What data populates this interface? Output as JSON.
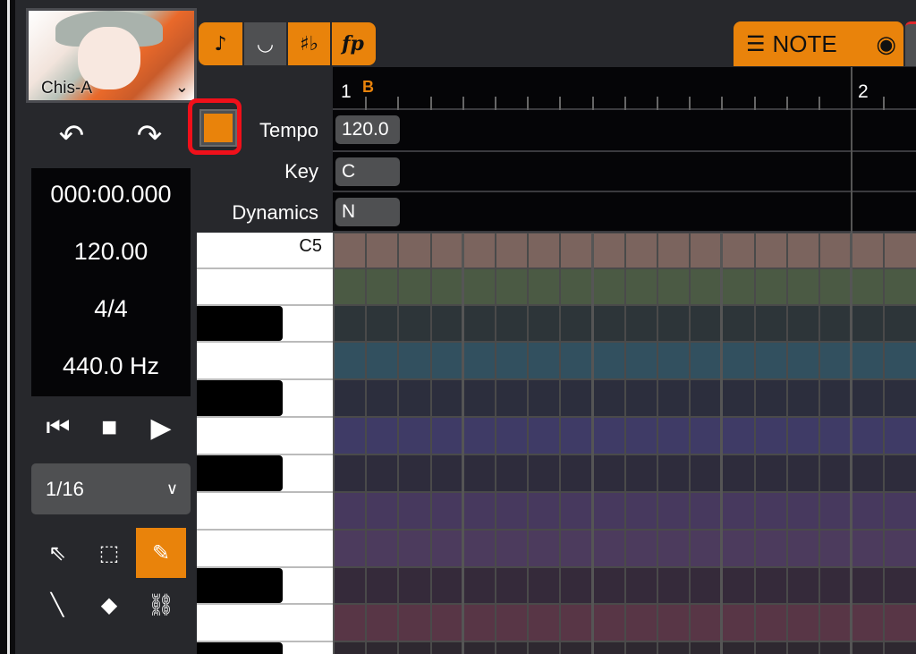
{
  "singer": {
    "name": "Chis-A",
    "dropdown_icon": "chevron-down"
  },
  "history": {
    "undo_icon": "undo",
    "redo_icon": "redo"
  },
  "info": {
    "time": "000:00.000",
    "tempo": "120.00",
    "time_signature": "4/4",
    "pitch": "440.0 Hz"
  },
  "transport": {
    "rewind_icon": "skip-back",
    "stop_icon": "stop",
    "play_icon": "play"
  },
  "snap": {
    "value": "1/16"
  },
  "tools": [
    {
      "name": "arrow",
      "glyph": "⇖",
      "active": false
    },
    {
      "name": "range-select",
      "glyph": "⬚",
      "active": false
    },
    {
      "name": "pencil",
      "glyph": "✎",
      "active": true
    },
    {
      "name": "line",
      "glyph": "╲",
      "active": false
    },
    {
      "name": "eraser",
      "glyph": "◆",
      "active": false
    },
    {
      "name": "link",
      "glyph": "⛓",
      "active": false
    }
  ],
  "toolbar": [
    {
      "name": "metronome",
      "glyph": "♪",
      "active": true
    },
    {
      "name": "drum",
      "glyph": "◡",
      "active": false
    },
    {
      "name": "sharp-flat",
      "glyph": "♯♭",
      "active": true
    },
    {
      "name": "dynamics",
      "glyph": "fp",
      "active": true
    }
  ],
  "note_tab": {
    "label": "NOTE",
    "icon": "eye"
  },
  "ruler": {
    "measure1": "1",
    "marker": "B",
    "measure2": "2"
  },
  "tracks": {
    "tempo": {
      "label": "Tempo",
      "value": "120.0"
    },
    "key": {
      "label": "Key",
      "value": "C"
    },
    "dynamics": {
      "label": "Dynamics",
      "value": "N"
    }
  },
  "piano": {
    "top_label": "C5"
  },
  "row_colors": [
    "#7b645e",
    "#4b5a44",
    "#2d3539",
    "#32505f",
    "#2c2e3d",
    "#3f3b66",
    "#2e2c3c",
    "#47395e",
    "#4c3b5d",
    "#352a3a",
    "#583646",
    "#2e2830"
  ],
  "colors": {
    "accent": "#e9830b",
    "highlight": "#f0101a"
  }
}
